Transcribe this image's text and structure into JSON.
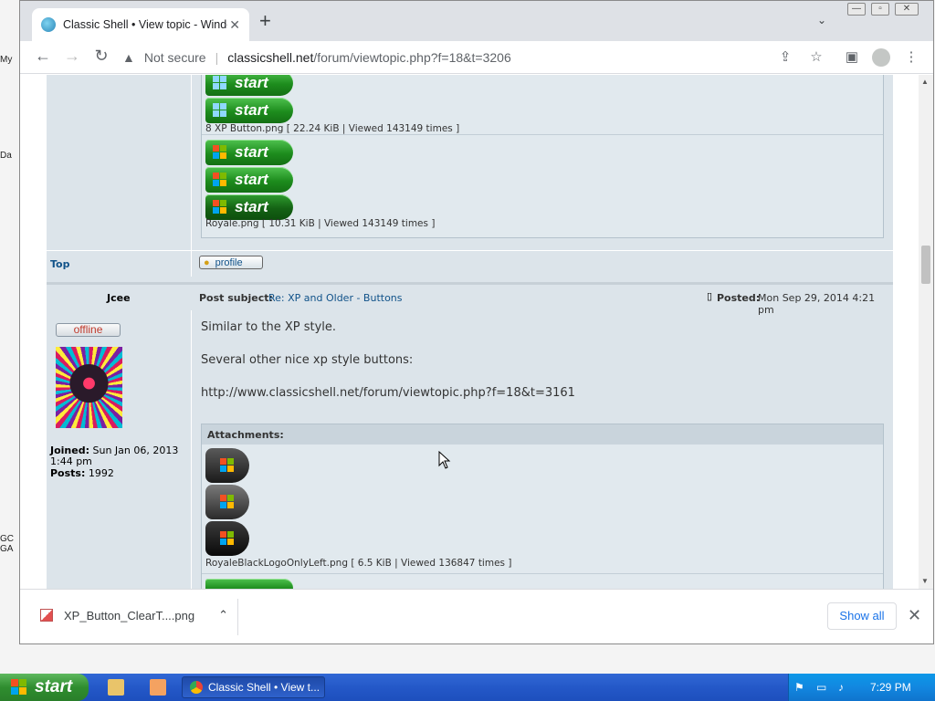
{
  "desktop": {
    "icons": [
      "My",
      "Da",
      "GC GA"
    ]
  },
  "browser": {
    "tab_title": "Classic Shell • View topic - Windows",
    "tab_close": "✕",
    "new_tab": "+",
    "tab_search": "⌄",
    "window_controls": {
      "minimize": "—",
      "maximize": "▫",
      "close": "✕"
    },
    "omnibox": {
      "security_icon": "warning-triangle",
      "security_text": "Not secure",
      "separator": "|",
      "host": "classicshell.net",
      "path": "/forum/viewtopic.php?f=18&t=3206"
    }
  },
  "forum": {
    "prev_post": {
      "attachments": [
        {
          "kind": "win8",
          "buttons": 2,
          "caption": "8 XP Button.png [ 22.24 KiB | Viewed 143149 times ]"
        },
        {
          "kind": "xp",
          "buttons": 3,
          "caption": "Royale.png [ 10.31 KiB | Viewed 143149 times ]"
        }
      ],
      "button_label": "start"
    },
    "footer": {
      "top_link": "Top",
      "profile_label": "profile"
    },
    "post": {
      "author": "Jcee",
      "subject_label": "Post subject:",
      "subject": "Re: XP and Older - Buttons",
      "posted_label": "Posted:",
      "posted_date": "Mon Sep 29, 2014 4:21 pm",
      "status": "offline",
      "joined_label": "Joined:",
      "joined_value": "Sun Jan 06, 2013 1:44 pm",
      "posts_label": "Posts:",
      "posts_value": "1992",
      "body_lines": [
        "Similar to the XP style.",
        "Several other nice xp style buttons:"
      ],
      "link": "http://www.classicshell.net/forum/viewtopic.php?f=18&t=3161",
      "attachments_label": "Attachments:",
      "attachment_caption": "RoyaleBlackLogoOnlyLeft.png [ 6.5 KiB | Viewed 136847 times ]"
    }
  },
  "download_bar": {
    "file_name": "XP_Button_ClearT....png",
    "show_all": "Show all",
    "close": "✕"
  },
  "taskbar": {
    "start_label": "start",
    "task_label": "Classic Shell • View t...",
    "clock": "7:29 PM"
  },
  "colors": {
    "forum_bg": "#dce4ea",
    "link": "#105289",
    "taskbar": "#245edb",
    "start_green": "#2f8d2f"
  }
}
